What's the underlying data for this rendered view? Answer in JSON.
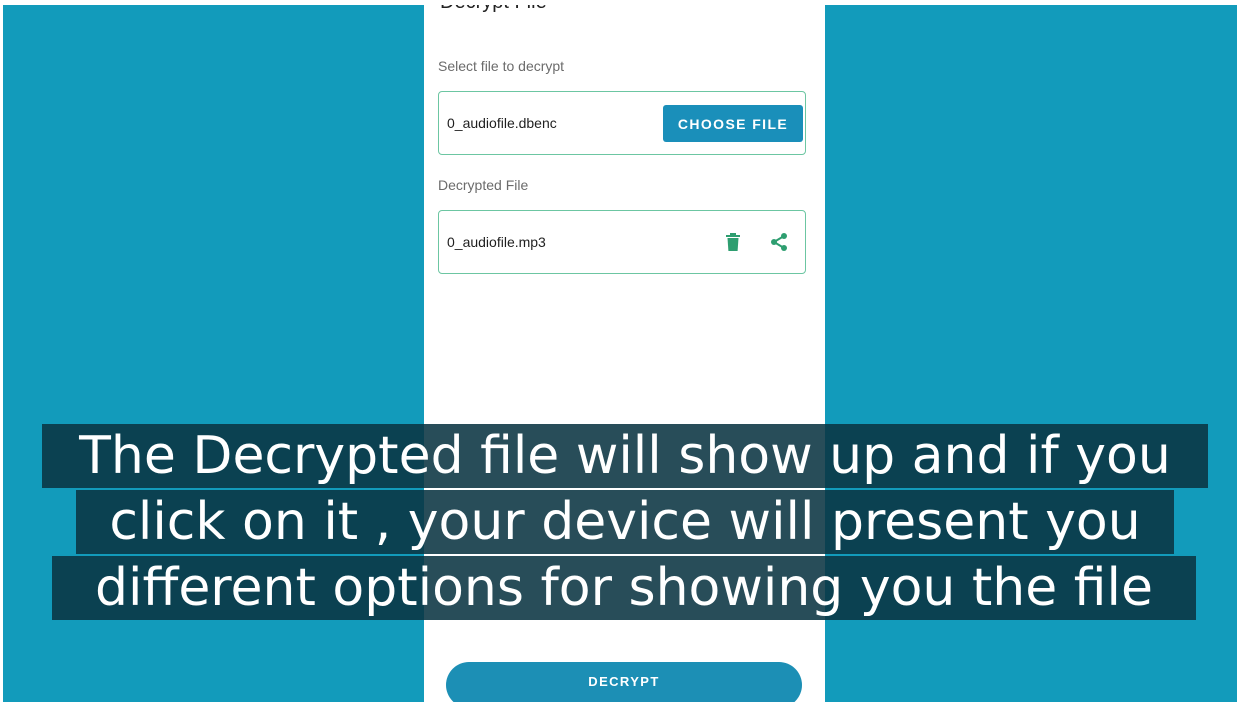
{
  "form": {
    "cut_title": "Decrypt File",
    "select_label": "Select file to decrypt",
    "selected_file": "0_audiofile.dbenc",
    "choose_button": "CHOOSE FILE",
    "decrypted_label": "Decrypted File",
    "decrypted_file": "0_audiofile.mp3",
    "decrypt_button": "DECRYPT"
  },
  "icons": {
    "delete": "trash-icon",
    "share": "share-icon"
  },
  "caption": {
    "line1": "The Decrypted file will show up and if you",
    "line2": "click on it , your device will  present you",
    "line3": "different options for showing you the file"
  },
  "colors": {
    "backdrop": "#129bbb",
    "accent": "#1a8fba",
    "box_border": "#6cc6a2",
    "icon_green": "#2e9e70",
    "caption_bg": "#0a3442"
  }
}
